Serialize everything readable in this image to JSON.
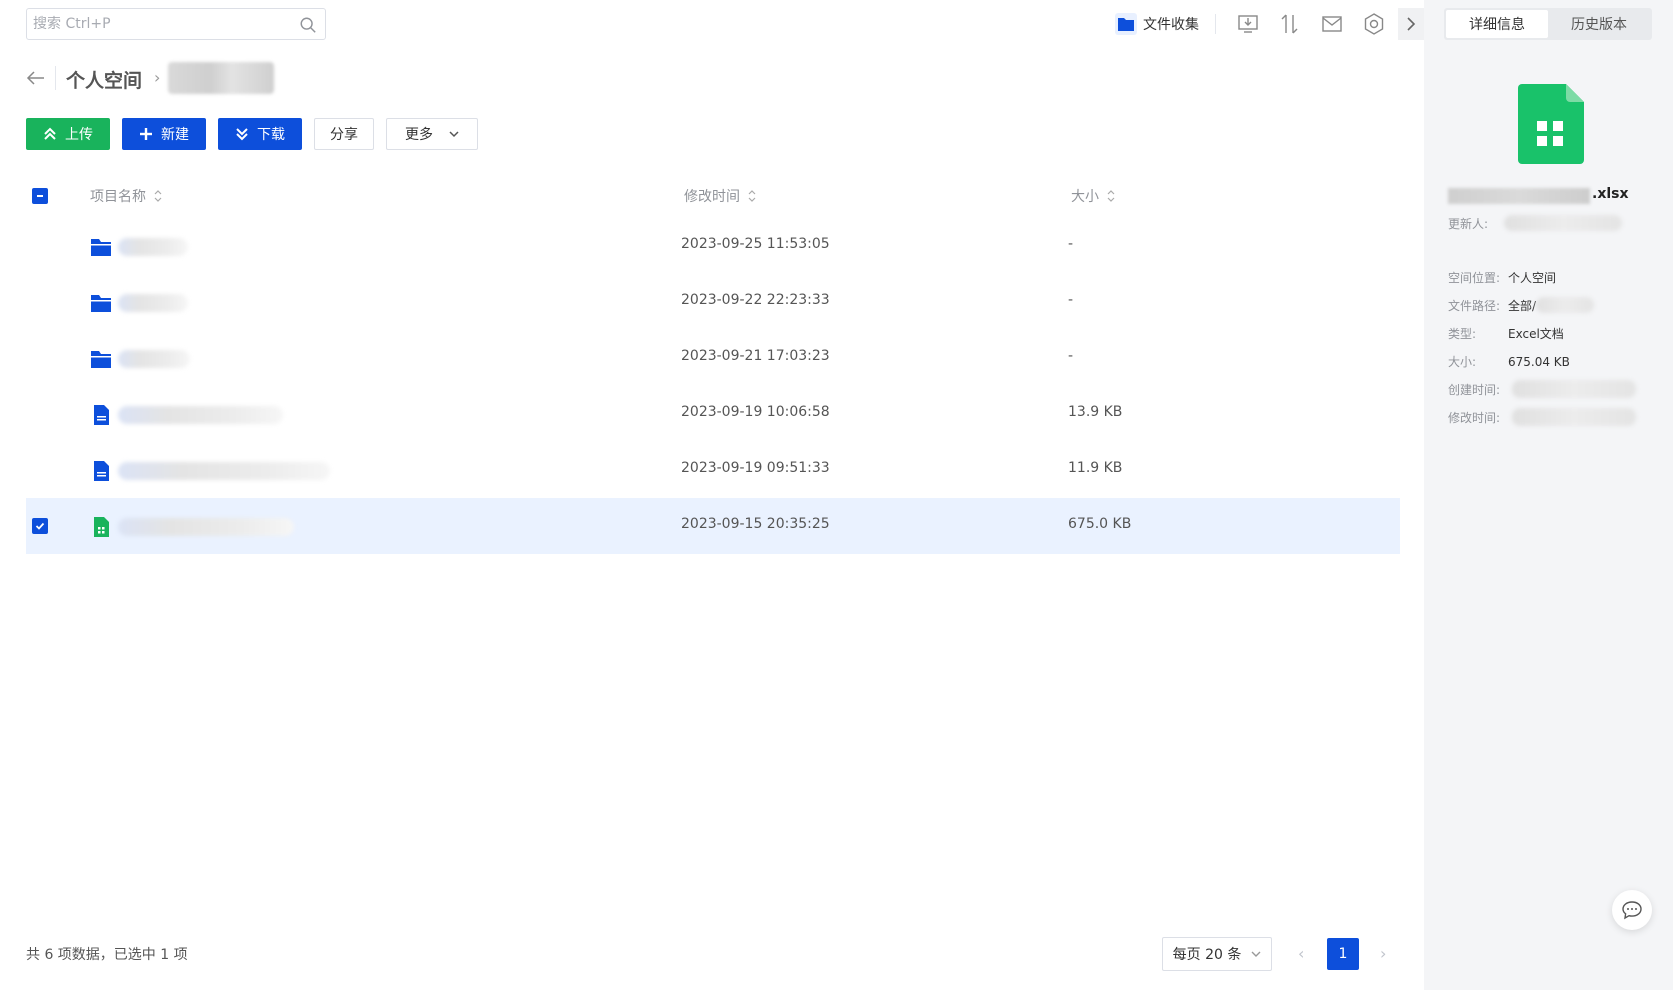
{
  "search": {
    "placeholder": "搜索 Ctrl+P"
  },
  "topbar": {
    "collect_label": "文件收集"
  },
  "breadcrumb": {
    "root": "个人空间",
    "separator": "›"
  },
  "toolbar": {
    "upload": "上传",
    "new": "新建",
    "download": "下载",
    "share": "分享",
    "more": "更多"
  },
  "table": {
    "headers": {
      "name": "项目名称",
      "modified": "修改时间",
      "size": "大小"
    },
    "rows": [
      {
        "type": "folder",
        "time": "2023-09-25 11:53:05",
        "size": "-"
      },
      {
        "type": "folder",
        "time": "2023-09-22 22:23:33",
        "size": "-"
      },
      {
        "type": "folder",
        "time": "2023-09-21 17:03:23",
        "size": "-"
      },
      {
        "type": "doc",
        "time": "2023-09-19 10:06:58",
        "size": "13.9 KB"
      },
      {
        "type": "doc",
        "time": "2023-09-19 09:51:33",
        "size": "11.9 KB"
      },
      {
        "type": "sheet",
        "time": "2023-09-15 20:35:25",
        "size": "675.0 KB",
        "selected": true
      }
    ]
  },
  "footer": {
    "total_text": "共 6 项数据，已选中 1 项",
    "page_size": "每页 20 条",
    "current_page": "1"
  },
  "side": {
    "tabs": [
      "详细信息",
      "历史版本"
    ],
    "file_ext": ".xlsx",
    "updater_label": "更新人:",
    "location_label": "空间位置:",
    "location_value": "个人空间",
    "path_label": "文件路径:",
    "path_value": "全部/",
    "type_label": "类型:",
    "type_value": "Excel文档",
    "size_label": "大小:",
    "size_value": "675.04 KB",
    "created_label": "创建时间:",
    "modified_label": "修改时间:"
  },
  "colors": {
    "primary": "#0d4fdb",
    "green": "#19b35c",
    "selected_row": "#eaf2ff"
  }
}
